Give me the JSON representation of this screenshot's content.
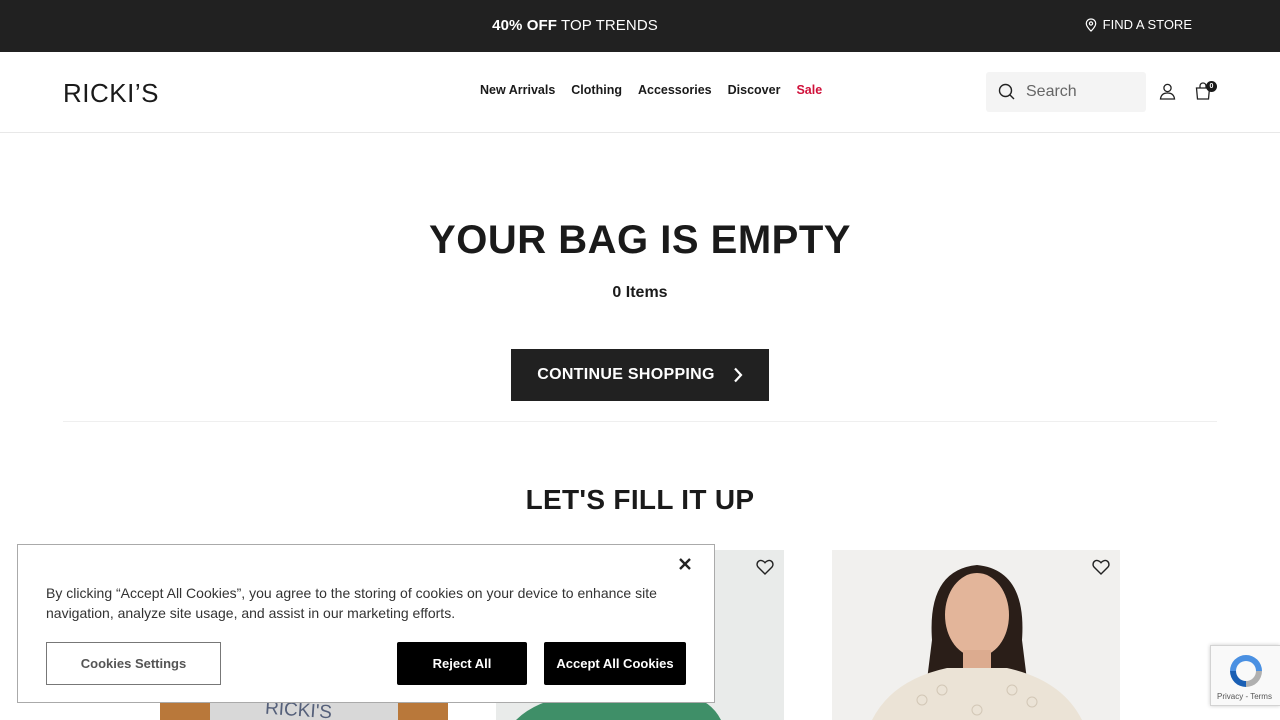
{
  "promo": {
    "highlight": "40% OFF",
    "text": " TOP TRENDS",
    "find_store": "FIND A STORE"
  },
  "header": {
    "logo": "RICKI’S",
    "nav": [
      "New Arrivals",
      "Clothing",
      "Accessories",
      "Discover",
      "Sale"
    ],
    "search_placeholder": "Search",
    "bag_count": "0"
  },
  "cart": {
    "title": "YOUR BAG IS EMPTY",
    "items": "0 Items",
    "continue_label": "CONTINUE SHOPPING",
    "fill_title": "LET'S FILL IT UP"
  },
  "products": [
    {
      "logo_text": "RICKI'S"
    },
    {},
    {}
  ],
  "cookie_banner": {
    "text": "By clicking “Accept All Cookies”, you agree to the storing of cookies on your device to enhance site navigation, analyze site usage, and assist in our marketing efforts.",
    "settings_label": "Cookies Settings",
    "reject_label": "Reject All",
    "accept_label": "Accept All Cookies"
  },
  "recaptcha": {
    "links": "Privacy - Terms"
  },
  "colors": {
    "promo_bg": "#212121",
    "sale": "#d0103a",
    "button_bg": "#212121"
  }
}
